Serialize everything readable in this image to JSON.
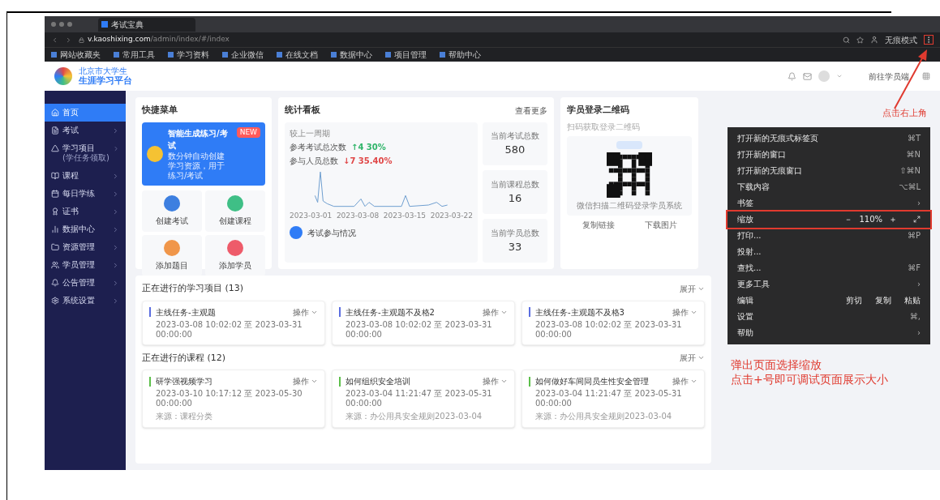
{
  "browser": {
    "tab_title": "考试宝典",
    "address_host": "v.kaoshixing.com",
    "address_path": "/admin/index/#/index",
    "profile": "无痕模式",
    "bookmarks": [
      "网站收藏夹",
      "常用工具",
      "学习资料",
      "企业微信",
      "在线文档",
      "数据中心",
      "项目管理",
      "帮助中心"
    ]
  },
  "header": {
    "logo_line1": "北京市大学生",
    "logo_line2": "生涯学习平台",
    "user_link": "前往学员端"
  },
  "sidebar": [
    {
      "label": "首页",
      "selected": true,
      "children": false
    },
    {
      "label": "考试",
      "selected": false,
      "children": true
    },
    {
      "label": "学习项目",
      "note": "(学任务领取)",
      "selected": false,
      "children": true
    },
    {
      "label": "课程",
      "selected": false,
      "children": true
    },
    {
      "label": "每日学练",
      "selected": false,
      "children": true
    },
    {
      "label": "证书",
      "selected": false,
      "children": true
    },
    {
      "label": "数据中心",
      "selected": false,
      "children": true
    },
    {
      "label": "资源管理",
      "selected": false,
      "children": true
    },
    {
      "label": "学员管理",
      "selected": false,
      "children": true
    },
    {
      "label": "公告管理",
      "selected": false,
      "children": true
    },
    {
      "label": "系统设置",
      "selected": false,
      "children": true
    }
  ],
  "quick_menu": {
    "title": "快捷菜单",
    "banner_title": "智能生成练习/考试",
    "badge": "NEW",
    "banner_text": "数分钟自动创建学习资源，用于练习/考试",
    "actions": [
      {
        "label": "创建考试",
        "color": "#3d7fe0"
      },
      {
        "label": "创建课程",
        "color": "#3fbf86"
      },
      {
        "label": "添加题目",
        "color": "#f0964a"
      },
      {
        "label": "添加学员",
        "color": "#ee5b6a"
      }
    ]
  },
  "stats": {
    "title": "统计看板",
    "more": "查看更多",
    "period": "较上一周期",
    "legend": [
      {
        "label": "参考考试总次数",
        "delta": "↑4 30%",
        "color": "#31b56a"
      },
      {
        "label": "参与人员总数",
        "delta": "↓7 35.40%",
        "color": "#e04848"
      }
    ],
    "axis_dates": [
      "2023-03-01",
      "2023-03-08",
      "2023-03-15",
      "2023-03-22"
    ],
    "footer": "考试参与情况",
    "totals": [
      {
        "label": "当前考试总数",
        "value": "580"
      },
      {
        "label": "当前课程总数",
        "value": "16"
      },
      {
        "label": "当前学员总数",
        "value": "33"
      }
    ]
  },
  "qr": {
    "title": "学员登录二维码",
    "subtitle": "扫码获取登录二维码",
    "caption": "微信扫描二维码登录学员系统",
    "actions": [
      "复制链接",
      "下载图片"
    ]
  },
  "sections": [
    {
      "title": "正在进行的学习项目",
      "count": "(13)",
      "toggle": "展开",
      "color": "#5b6ee0",
      "items": [
        {
          "title": "主线任务-主观题",
          "action": "操作",
          "dates": "2023-03-08 10:02:02 至 2023-03-31 00:00:00"
        },
        {
          "title": "主线任务-主观题不及格2",
          "action": "操作",
          "dates": "2023-03-08 10:02:02 至 2023-03-31 00:00:00"
        },
        {
          "title": "主线任务-主观题不及格3",
          "action": "操作",
          "dates": "2023-03-08 10:02:02 至 2023-03-31 00:00:00"
        }
      ]
    },
    {
      "title": "正在进行的课程",
      "count": "(12)",
      "toggle": "展开",
      "color": "#5cbf4a",
      "items": [
        {
          "title": "研学强视频学习",
          "action": "操作",
          "dates": "2023-03-10 10:17:12 至 2023-05-30 00:00:00",
          "source": "来源：课程分类"
        },
        {
          "title": "如何组织安全培训",
          "action": "操作",
          "dates": "2023-03-04 11:21:47 至 2023-05-31 00:00:00",
          "source": "来源：办公用具安全规则2023-03-04"
        },
        {
          "title": "如何做好车间同员生性安全管理",
          "action": "操作",
          "dates": "2023-03-04 11:21:47 至 2023-05-31 00:00:00",
          "source": "来源：办公用具安全规则2023-03-04"
        }
      ]
    }
  ],
  "menu": [
    {
      "kind": "item",
      "label": "打开新的无痕式标签页",
      "shortcut": "⌘T",
      "highlighted": false
    },
    {
      "kind": "item",
      "label": "打开新的窗口",
      "shortcut": "⌘N",
      "highlighted": false
    },
    {
      "kind": "item",
      "label": "打开新的无痕窗口",
      "shortcut": "⇧⌘N",
      "highlighted": false
    },
    {
      "kind": "item",
      "label": "下载内容",
      "shortcut": "⌥⌘L",
      "highlighted": false
    },
    {
      "kind": "item",
      "label": "书签",
      "shortcut": "›",
      "highlighted": false
    },
    {
      "kind": "zoom",
      "label": "缩放",
      "minus": "－",
      "value": "110%",
      "plus": "＋",
      "highlighted": true
    },
    {
      "kind": "item",
      "label": "打印...",
      "shortcut": "⌘P",
      "highlighted": false
    },
    {
      "kind": "item",
      "label": "投射...",
      "highlighted": false
    },
    {
      "kind": "item",
      "label": "查找...",
      "shortcut": "⌘F",
      "highlighted": false
    },
    {
      "kind": "item",
      "label": "更多工具",
      "shortcut": "›",
      "highlighted": false
    },
    {
      "kind": "edit",
      "label": "编辑",
      "buttons": [
        "剪切",
        "复制",
        "粘贴"
      ],
      "highlighted": false
    },
    {
      "kind": "item",
      "label": "设置",
      "shortcut": "⌘,",
      "highlighted": false
    },
    {
      "kind": "item",
      "label": "帮助",
      "shortcut": "›",
      "highlighted": false
    }
  ],
  "annotations": {
    "top": "点击右上角",
    "bottom": [
      "弹出页面选择缩放",
      "点击+号即可调试页面展示大小"
    ]
  }
}
